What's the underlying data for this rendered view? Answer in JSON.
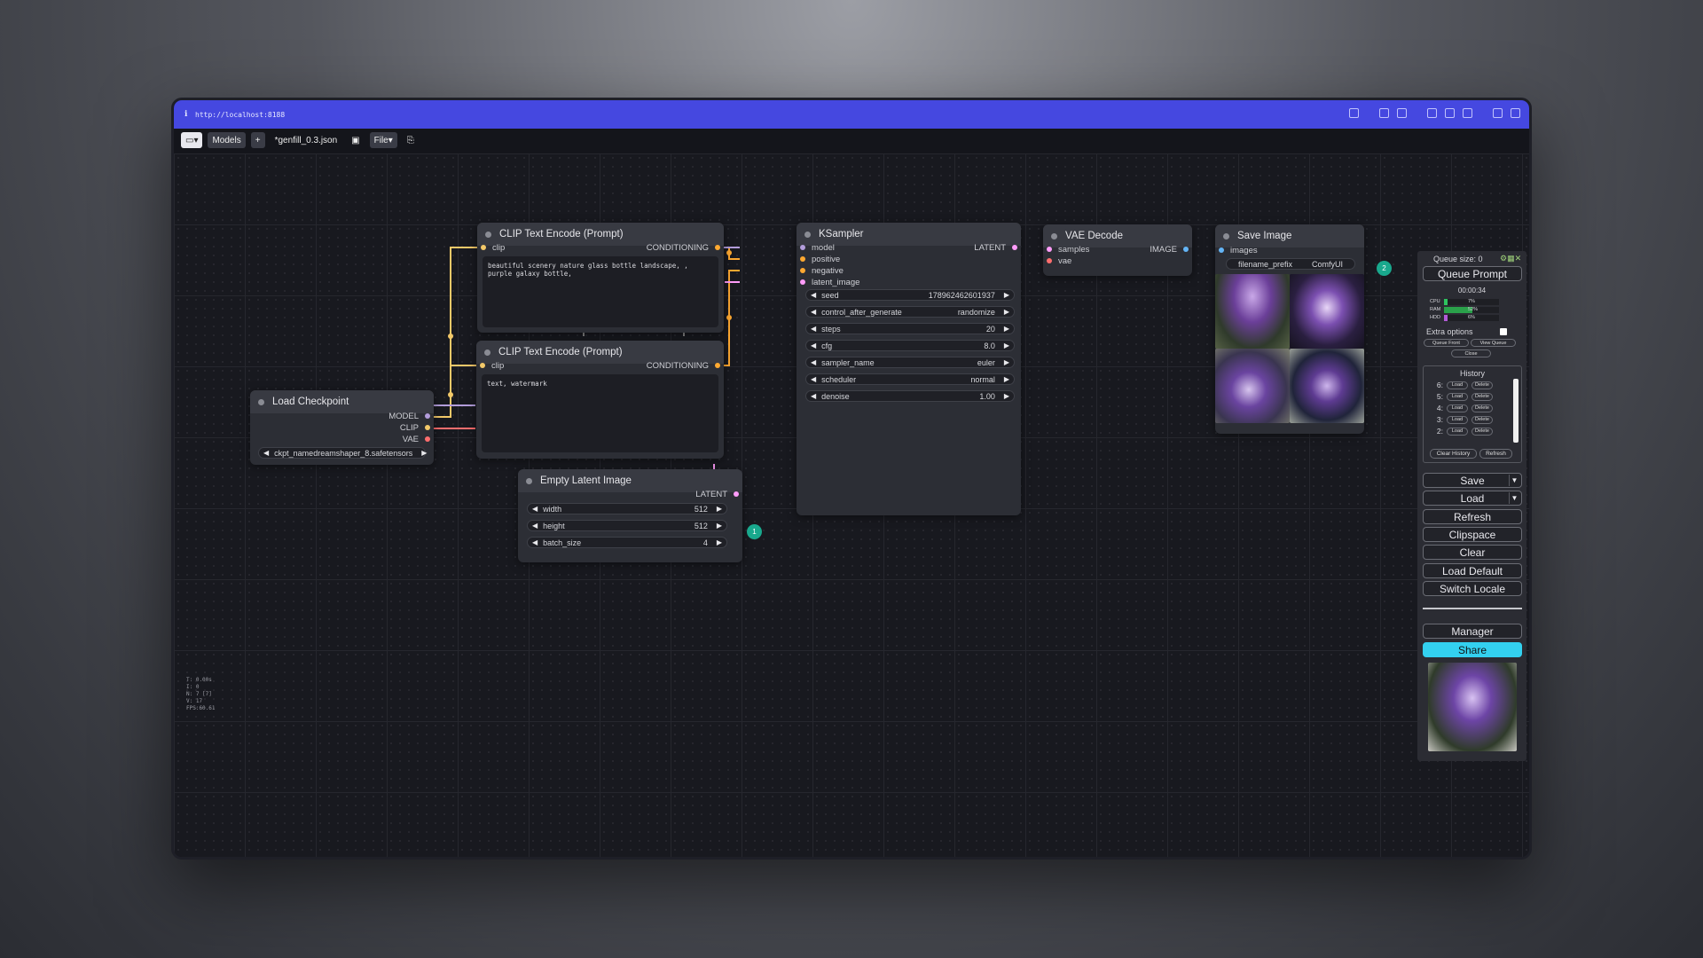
{
  "browser": {
    "url": "http://localhost:8188"
  },
  "menubar": {
    "models": "Models",
    "plus": "+",
    "filename": "*genfill_0.3.json",
    "file": "File"
  },
  "nodes": {
    "clip1": {
      "title": "CLIP Text Encode (Prompt)",
      "in": "clip",
      "out": "CONDITIONING",
      "text": "beautiful scenery nature glass bottle landscape, , purple galaxy bottle,"
    },
    "clip2": {
      "title": "CLIP Text Encode (Prompt)",
      "in": "clip",
      "out": "CONDITIONING",
      "text": "text, watermark"
    },
    "checkpoint": {
      "title": "Load Checkpoint",
      "outs": [
        "MODEL",
        "CLIP",
        "VAE"
      ],
      "widget_label": "ckpt_name",
      "widget_value": "dreamshaper_8.safetensors"
    },
    "ksampler": {
      "title": "KSampler",
      "ins": [
        "model",
        "positive",
        "negative",
        "latent_image"
      ],
      "out": "LATENT",
      "widgets": [
        {
          "label": "seed",
          "value": "178962462601937"
        },
        {
          "label": "control_after_generate",
          "value": "randomize"
        },
        {
          "label": "steps",
          "value": "20"
        },
        {
          "label": "cfg",
          "value": "8.0"
        },
        {
          "label": "sampler_name",
          "value": "euler"
        },
        {
          "label": "scheduler",
          "value": "normal"
        },
        {
          "label": "denoise",
          "value": "1.00"
        }
      ]
    },
    "vae": {
      "title": "VAE Decode",
      "ins": [
        "samples",
        "vae"
      ],
      "out": "IMAGE"
    },
    "save": {
      "title": "Save Image",
      "in": "images",
      "prefix_label": "filename_prefix",
      "prefix_value": "ComfyUI"
    },
    "latent": {
      "title": "Empty Latent Image",
      "out": "LATENT",
      "widgets": [
        {
          "label": "width",
          "value": "512"
        },
        {
          "label": "height",
          "value": "512"
        },
        {
          "label": "batch_size",
          "value": "4"
        }
      ]
    }
  },
  "badges": {
    "a": "1",
    "b": "2"
  },
  "panel": {
    "queue_size": "Queue size: 0",
    "queue_prompt": "Queue Prompt",
    "timer": "00:00:34",
    "cpu_label": "CPU",
    "cpu": "7%",
    "ram_label": "RAM",
    "ram": "52%",
    "hdd_label": "HDD",
    "hdd": "6%",
    "extra_options": "Extra options",
    "queue_front": "Queue Front",
    "view_queue": "View Queue",
    "close": "Close",
    "history_title": "History",
    "history": [
      "6:",
      "5:",
      "4:",
      "3:",
      "2:"
    ],
    "load": "Load",
    "delete": "Delete",
    "clear_history": "Clear History",
    "refresh_small": "Refresh",
    "buttons": [
      "Save",
      "Load",
      "Refresh",
      "Clipspace",
      "Clear",
      "Load Default",
      "Switch Locale"
    ],
    "manager": "Manager",
    "share": "Share"
  },
  "stats": [
    "T: 0.00s",
    "I: 0",
    "N: 7 [7]",
    "V: 17",
    "FPS:60.61"
  ],
  "colors": {
    "titlebar": "#4548e0",
    "share": "#33d1f0",
    "badge": "#19a88d",
    "clip_wire": "#f3c969",
    "model_wire": "#b39ddb",
    "vae_wire": "#ff6e6e",
    "latent_wire": "#ff9cf9",
    "cond_wire": "#ffa931",
    "image_wire": "#64b5f6"
  }
}
